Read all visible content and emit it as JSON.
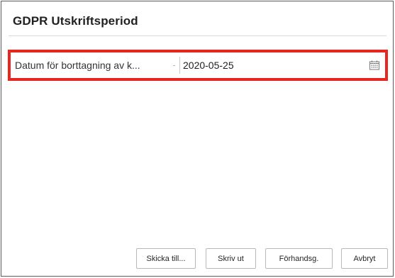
{
  "dialog": {
    "title": "GDPR Utskriftsperiod"
  },
  "field": {
    "label": "Datum för borttagning av k...",
    "value": "2020-05-25",
    "icon": "calendar-icon"
  },
  "buttons": {
    "send_to": "Skicka till...",
    "print": "Skriv ut",
    "preview": "Förhandsg.",
    "cancel": "Avbryt"
  },
  "colors": {
    "highlight": "#e8251f",
    "border": "#5a5a5a"
  }
}
